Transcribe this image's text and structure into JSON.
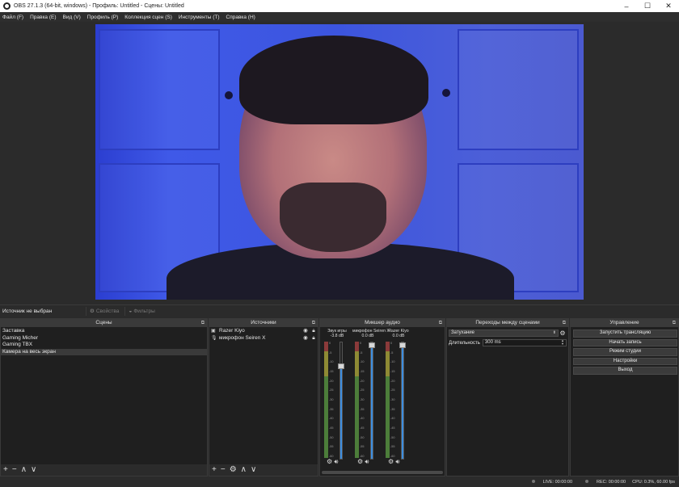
{
  "window": {
    "title": "OBS 27.1.3 (64-bit, windows) - Профиль: Untitled - Сцены: Untitled",
    "minimize": "–",
    "maximize": "☐",
    "close": "✕"
  },
  "menu": {
    "items": [
      "Файл (F)",
      "Правка (E)",
      "Вид (V)",
      "Профиль (P)",
      "Коллекция сцен (S)",
      "Инструменты (T)",
      "Справка (H)"
    ]
  },
  "source_toolbar": {
    "no_source": "Источник не выбран",
    "properties": "Свойства",
    "filters": "Фильтры",
    "properties_icon": "gear-icon",
    "filters_icon": "filter-icon"
  },
  "scenes": {
    "title": "Сцены",
    "items": [
      "Заставка",
      "Gaming Micher",
      "Gaming TBX",
      "Камера на весь экран"
    ],
    "active_index": 3,
    "footer": [
      "+",
      "−",
      "∧",
      "∨"
    ]
  },
  "sources": {
    "title": "Источники",
    "items": [
      {
        "name": "Razer Kiyo",
        "icon": "camera-icon"
      },
      {
        "name": "микрофон Seiren X",
        "icon": "microphone-icon"
      }
    ],
    "footer": [
      "+",
      "−",
      "⚙",
      "∧",
      "∨"
    ]
  },
  "mixer": {
    "title": "Микшер аудио",
    "channels": [
      {
        "name": "Звук игры",
        "db": "-3.8 dB",
        "level": 0.81
      },
      {
        "name": "микрофон Seiren X",
        "db": "0.0 dB",
        "level": 1.0
      },
      {
        "name": "Razer Kiyo",
        "db": "0.0 dB",
        "level": 1.0
      }
    ],
    "ticks": [
      "0",
      "-5",
      "-10",
      "-15",
      "-20",
      "-25",
      "-30",
      "-35",
      "-40",
      "-45",
      "-50",
      "-55",
      "-60"
    ],
    "controls": "⚙ 🔊"
  },
  "transitions": {
    "title": "Переходы между сценами",
    "selected": "Затухание",
    "duration_label": "Длительность",
    "duration_value": "300 ms"
  },
  "controls": {
    "title": "Управление",
    "buttons": [
      "Запустить трансляцию",
      "Начать запись",
      "Режим студии",
      "Настройки",
      "Выход"
    ]
  },
  "status": {
    "live": "LIVE: 00:00:00",
    "rec": "REC: 00:00:00",
    "cpu": "CPU: 0.3%, 60.00 fps"
  },
  "colors": {
    "accent_fader": "#3d8ee0",
    "panel_bg": "#1f1f1f",
    "title_bg": "#3a3a3a"
  }
}
